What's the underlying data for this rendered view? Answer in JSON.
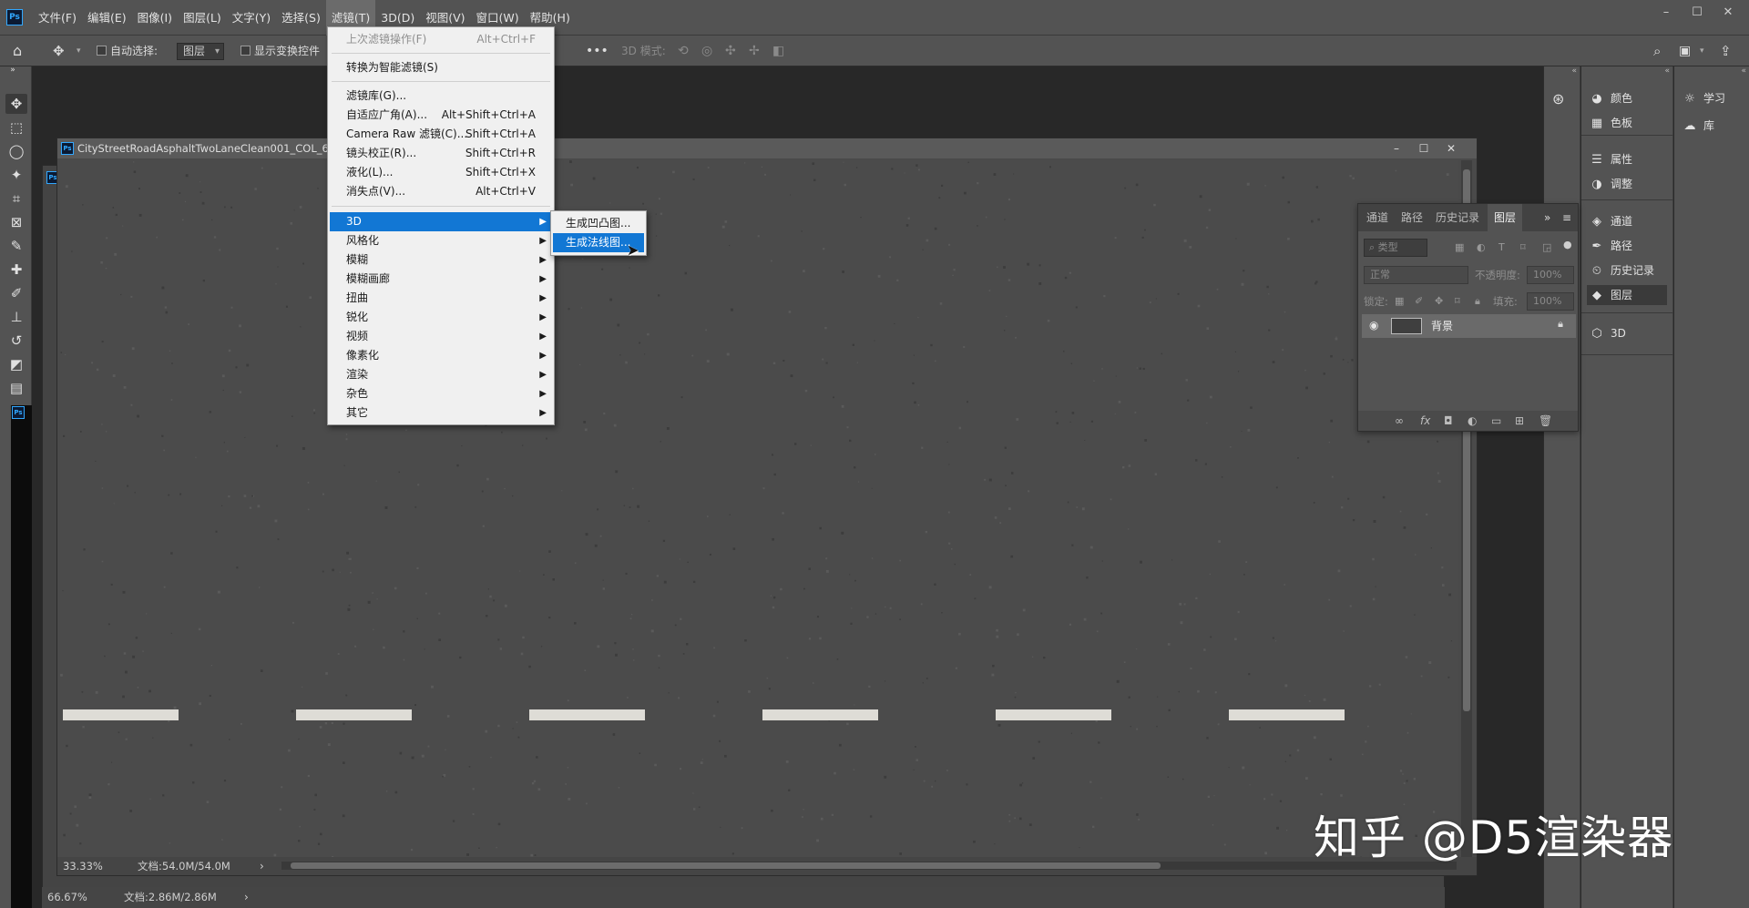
{
  "app": {
    "logo": "Ps"
  },
  "menubar": [
    {
      "label": "文件(F)",
      "active": false
    },
    {
      "label": "编辑(E)",
      "active": false
    },
    {
      "label": "图像(I)",
      "active": false
    },
    {
      "label": "图层(L)",
      "active": false
    },
    {
      "label": "文字(Y)",
      "active": false
    },
    {
      "label": "选择(S)",
      "active": false
    },
    {
      "label": "滤镜(T)",
      "active": true
    },
    {
      "label": "3D(D)",
      "active": false
    },
    {
      "label": "视图(V)",
      "active": false
    },
    {
      "label": "窗口(W)",
      "active": false
    },
    {
      "label": "帮助(H)",
      "active": false
    }
  ],
  "options_bar": {
    "auto_select_label": "自动选择:",
    "auto_select_target": "图层",
    "show_transform_label": "显示变换控件",
    "mode_3d_label": "3D 模式:"
  },
  "filter_menu": {
    "last_filter": {
      "label": "上次滤镜操作(F)",
      "shortcut": "Alt+Ctrl+F"
    },
    "convert_smart": "转换为智能滤镜(S)",
    "group1": [
      {
        "label": "滤镜库(G)...",
        "shortcut": ""
      },
      {
        "label": "自适应广角(A)...",
        "shortcut": "Alt+Shift+Ctrl+A"
      },
      {
        "label": "Camera Raw 滤镜(C)...",
        "shortcut": "Shift+Ctrl+A"
      },
      {
        "label": "镜头校正(R)...",
        "shortcut": "Shift+Ctrl+R"
      },
      {
        "label": "液化(L)...",
        "shortcut": "Shift+Ctrl+X"
      },
      {
        "label": "消失点(V)...",
        "shortcut": "Alt+Ctrl+V"
      }
    ],
    "group2": [
      {
        "label": "3D",
        "highlighted": true
      },
      {
        "label": "风格化",
        "highlighted": false
      },
      {
        "label": "模糊",
        "highlighted": false
      },
      {
        "label": "模糊画廊",
        "highlighted": false
      },
      {
        "label": "扭曲",
        "highlighted": false
      },
      {
        "label": "锐化",
        "highlighted": false
      },
      {
        "label": "视频",
        "highlighted": false
      },
      {
        "label": "像素化",
        "highlighted": false
      },
      {
        "label": "渲染",
        "highlighted": false
      },
      {
        "label": "杂色",
        "highlighted": false
      },
      {
        "label": "其它",
        "highlighted": false
      }
    ],
    "submenu_3d": [
      {
        "label": "生成凹凸图...",
        "highlighted": false
      },
      {
        "label": "生成法线图...",
        "highlighted": true
      }
    ]
  },
  "document": {
    "title": "CityStreetRoadAsphaltTwoLaneClean001_COL_6K.jp",
    "zoom": "33.33%",
    "doc_size": "文档:54.0M/54.0M",
    "asphalt_color": "#4b4b4b",
    "lane_marking_color": "#dedcd6",
    "lane_dashes": 6
  },
  "back_document": {
    "zoom": "66.67%",
    "doc_size": "文档:2.86M/2.86M"
  },
  "layers_panel": {
    "tabs": [
      {
        "label": "通道",
        "active": false
      },
      {
        "label": "路径",
        "active": false
      },
      {
        "label": "历史记录",
        "active": false
      },
      {
        "label": "图层",
        "active": true
      }
    ],
    "search_placeholder": "类型",
    "blend_mode": "正常",
    "opacity_label": "不透明度:",
    "opacity_value": "100%",
    "lock_label": "锁定:",
    "fill_label": "填充:",
    "fill_value": "100%",
    "layers": [
      {
        "name": "背景",
        "visible": true,
        "locked": true
      }
    ]
  },
  "dock_middle": [
    {
      "label": "颜色",
      "icon": "color-icon"
    },
    {
      "label": "色板",
      "icon": "swatches-icon"
    },
    {
      "label": "属性",
      "icon": "properties-icon"
    },
    {
      "label": "调整",
      "icon": "adjustments-icon"
    },
    {
      "label": "通道",
      "icon": "channels-icon"
    },
    {
      "label": "路径",
      "icon": "paths-icon"
    },
    {
      "label": "历史记录",
      "icon": "history-icon"
    },
    {
      "label": "图层",
      "icon": "layers-icon"
    },
    {
      "label": "3D",
      "icon": "cube-icon"
    }
  ],
  "dock_right": [
    {
      "label": "学习",
      "icon": "lightbulb-icon"
    },
    {
      "label": "库",
      "icon": "library-icon"
    }
  ],
  "watermark": "知乎 @D5渲染器"
}
